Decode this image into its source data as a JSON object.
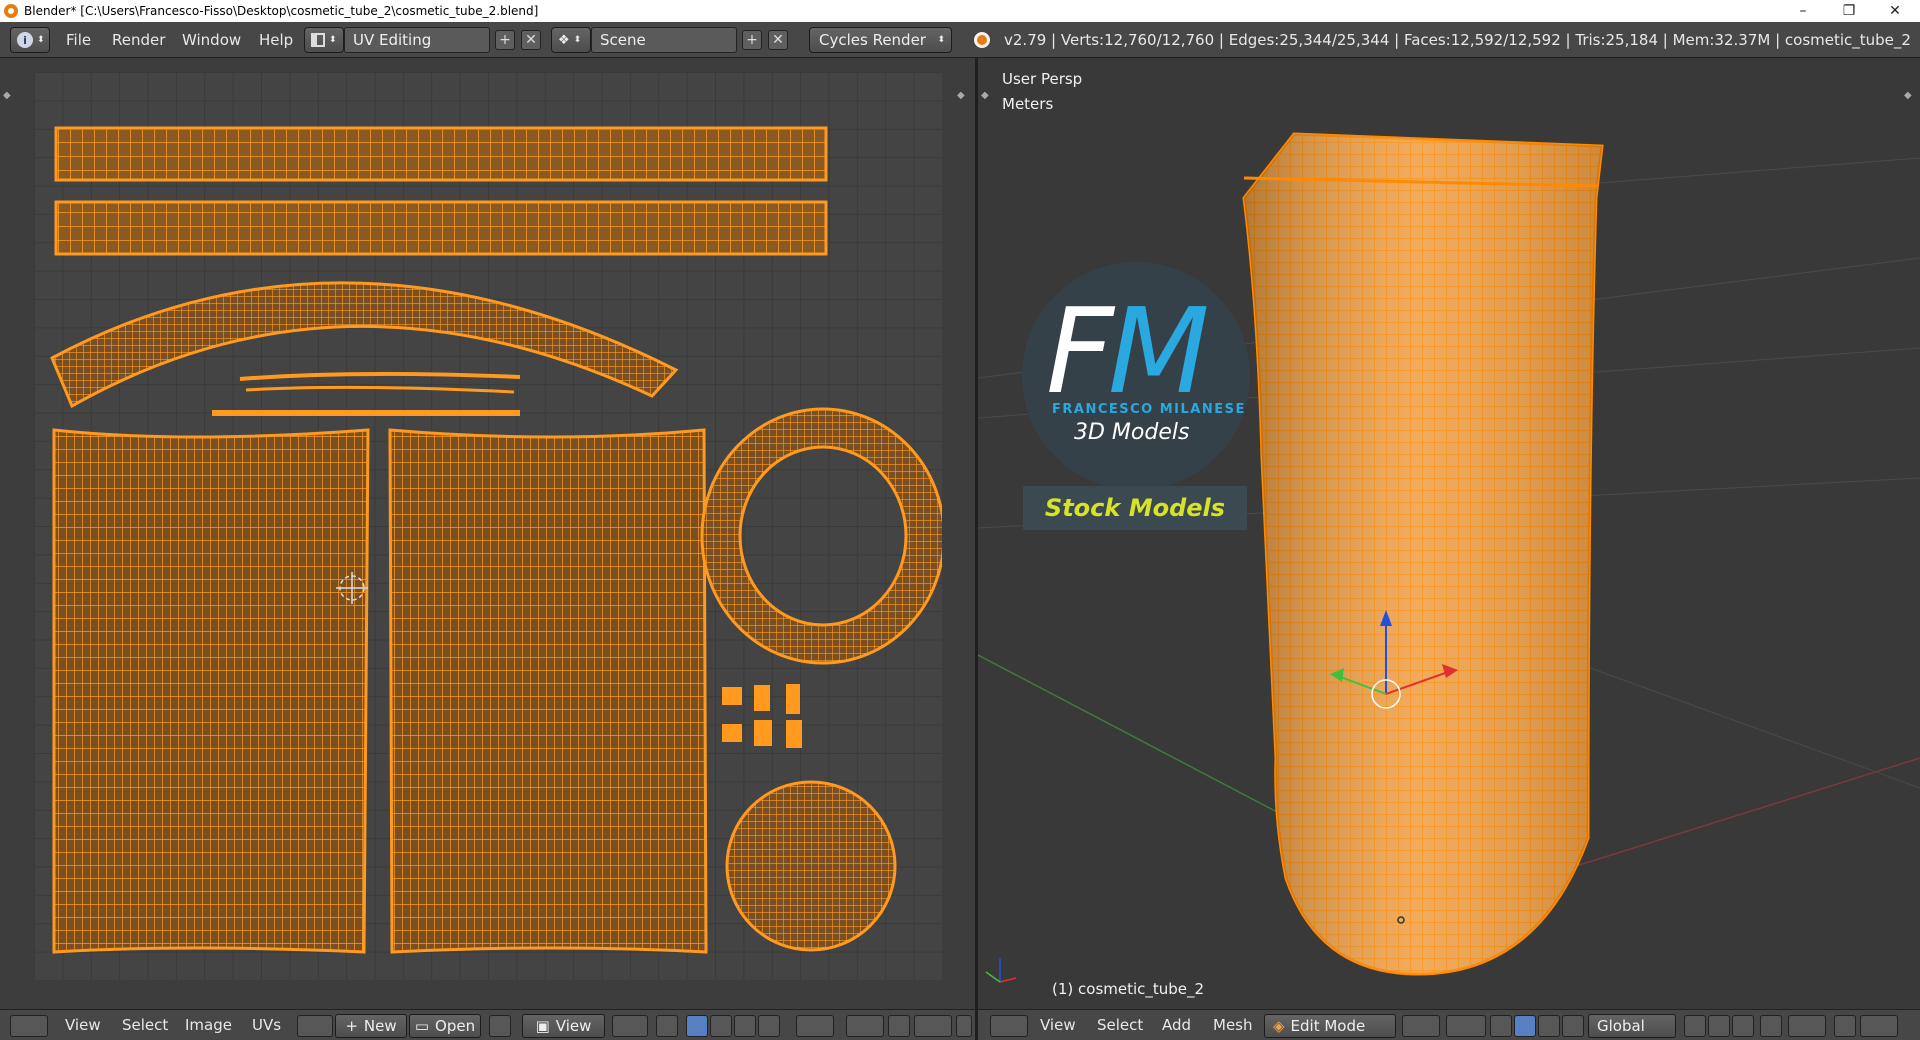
{
  "window": {
    "title": "Blender* [C:\\Users\\Francesco-Fisso\\Desktop\\cosmetic_tube_2\\cosmetic_tube_2.blend]",
    "minimize_glyph": "–",
    "maximize_glyph": "❐",
    "close_glyph": "✕"
  },
  "info_header": {
    "editor_type_icon": "info-icon",
    "menus": [
      "File",
      "Render",
      "Window",
      "Help"
    ],
    "screen_layout": "UV Editing",
    "scene": "Scene",
    "render_engine": "Cycles Render",
    "add_glyph": "+",
    "remove_glyph": "✕",
    "stats": "v2.79 | Verts:12,760/12,760 | Edges:25,344/25,344 | Faces:12,592/12,592 | Tris:25,184 | Mem:32.37M | cosmetic_tube_2"
  },
  "viewport": {
    "view_label": "User Persp",
    "units_label": "Meters",
    "object_label": "(1) cosmetic_tube_2",
    "logo": {
      "initials_f": "F",
      "initials_m": "M",
      "name": "FRANCESCO MILANESE",
      "tagline": "3D Models",
      "stock": "Stock Models"
    }
  },
  "uv_footer": {
    "menus": [
      "View",
      "Select",
      "Image",
      "UVs"
    ],
    "new_label": "New",
    "open_label": "Open",
    "view_label": "View"
  },
  "viewport_footer": {
    "menus": [
      "View",
      "Select",
      "Add",
      "Mesh"
    ],
    "mode": "Edit Mode",
    "orientation": "Global"
  },
  "colors": {
    "uv_wire": "#ff9a1f",
    "uv_fill": "#8a5a25",
    "mesh_fill": "#f0a24a",
    "axis_x": "#e03030",
    "axis_y": "#40c040",
    "axis_z": "#2050e0",
    "accent": "#29a9e0",
    "stock_text": "#d6e326"
  }
}
